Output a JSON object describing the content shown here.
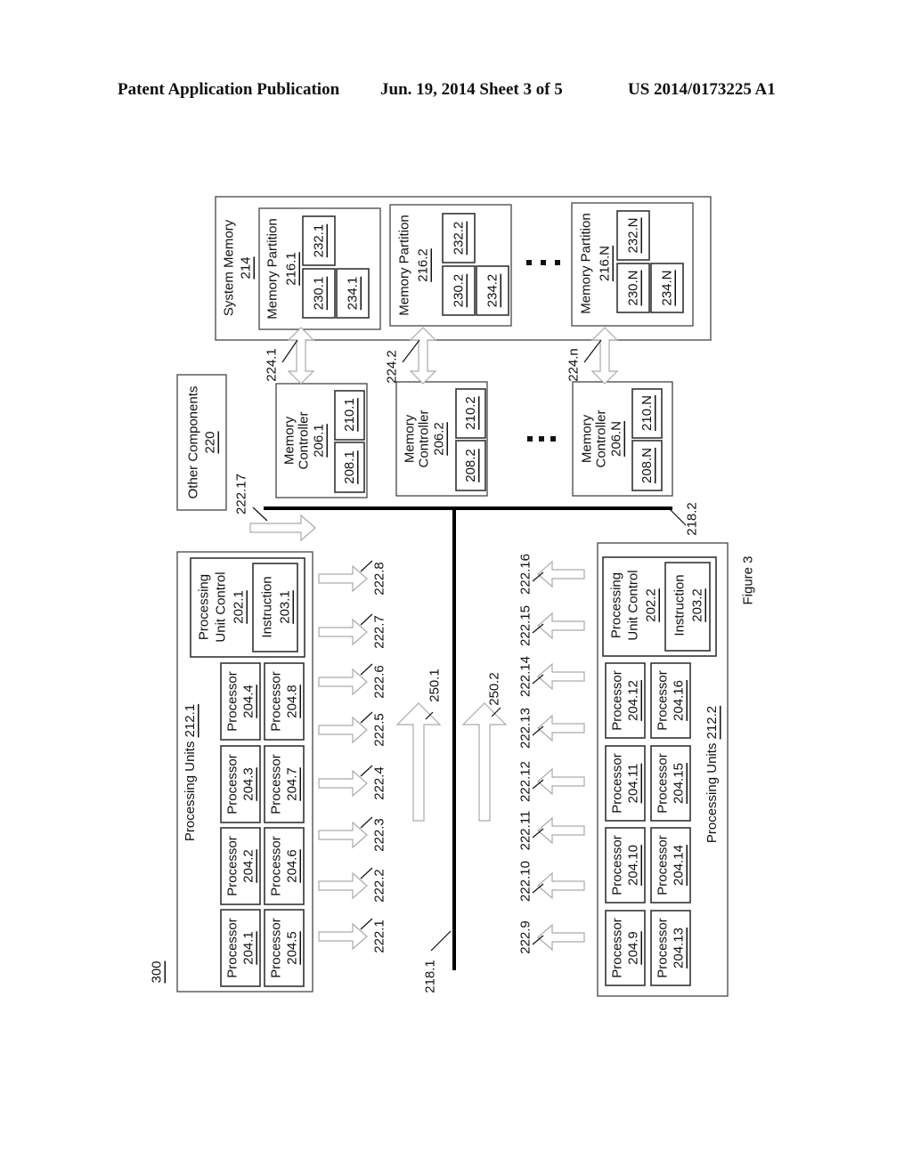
{
  "header": {
    "left": "Patent Application Publication",
    "center": "Jun. 19, 2014  Sheet 3 of 5",
    "right": "US 2014/0173225 A1"
  },
  "figure": {
    "number_ref": "300",
    "caption": "Figure 3"
  },
  "system_memory": {
    "label": "System Memory",
    "ref": "214",
    "partitions": [
      {
        "label": "Memory Partition",
        "ref": "216.1",
        "blocks": [
          "232.1",
          "230.1",
          "234.1"
        ]
      },
      {
        "label": "Memory Partition",
        "ref": "216.2",
        "blocks": [
          "232.2",
          "230.2",
          "234.2"
        ]
      },
      {
        "label": "Memory Partition",
        "ref": "216.N",
        "blocks": [
          "232.N",
          "230.N",
          "234.N"
        ]
      }
    ],
    "ellipsis": "..."
  },
  "memory_links": [
    "224.1",
    "224.2",
    "224.n"
  ],
  "memory_controllers": [
    {
      "line1": "Memory",
      "line2": "Controller",
      "ref": "206.1",
      "blocks": [
        "210.1",
        "208.1"
      ]
    },
    {
      "line1": "Memory",
      "line2": "Controller",
      "ref": "206.2",
      "blocks": [
        "210.2",
        "208.2"
      ]
    },
    {
      "line1": "Memory",
      "line2": "Controller",
      "ref": "206.N",
      "blocks": [
        "210.N",
        "208.N"
      ]
    }
  ],
  "controllers_ellipsis": "...",
  "other_components": {
    "label": "Other Components",
    "ref": "220"
  },
  "buses": {
    "bus1": "218.1",
    "bus2": "218.2"
  },
  "link_222_17": "222.17",
  "big_arrows": [
    "250.1",
    "250.2"
  ],
  "processing_units": [
    {
      "label": "Processing Units",
      "ref": "212.1",
      "processors": [
        {
          "label": "Processor",
          "ref": "204.1"
        },
        {
          "label": "Processor",
          "ref": "204.2"
        },
        {
          "label": "Processor",
          "ref": "204.3"
        },
        {
          "label": "Processor",
          "ref": "204.4"
        },
        {
          "label": "Processor",
          "ref": "204.5"
        },
        {
          "label": "Processor",
          "ref": "204.6"
        },
        {
          "label": "Processor",
          "ref": "204.7"
        },
        {
          "label": "Processor",
          "ref": "204.8"
        }
      ],
      "control": {
        "line1": "Processing",
        "line2": "Unit Control",
        "ref": "202.1"
      },
      "instruction": {
        "label": "Instruction",
        "ref": "203.1"
      },
      "links": [
        "222.1",
        "222.2",
        "222.3",
        "222.4",
        "222.5",
        "222.6",
        "222.7",
        "222.8"
      ]
    },
    {
      "label": "Processing Units",
      "ref": "212.2",
      "processors": [
        {
          "label": "Processor",
          "ref": "204.9"
        },
        {
          "label": "Processor",
          "ref": "204.10"
        },
        {
          "label": "Processor",
          "ref": "204.11"
        },
        {
          "label": "Processor",
          "ref": "204.12"
        },
        {
          "label": "Processor",
          "ref": "204.13"
        },
        {
          "label": "Processor",
          "ref": "204.14"
        },
        {
          "label": "Processor",
          "ref": "204.15"
        },
        {
          "label": "Processor",
          "ref": "204.16"
        }
      ],
      "control": {
        "line1": "Processing",
        "line2": "Unit Control",
        "ref": "202.2"
      },
      "instruction": {
        "label": "Instruction",
        "ref": "203.2"
      },
      "links": [
        "222.9",
        "222.10",
        "222.11",
        "222.12",
        "222.13",
        "222.14",
        "222.15",
        "222.16"
      ]
    }
  ]
}
